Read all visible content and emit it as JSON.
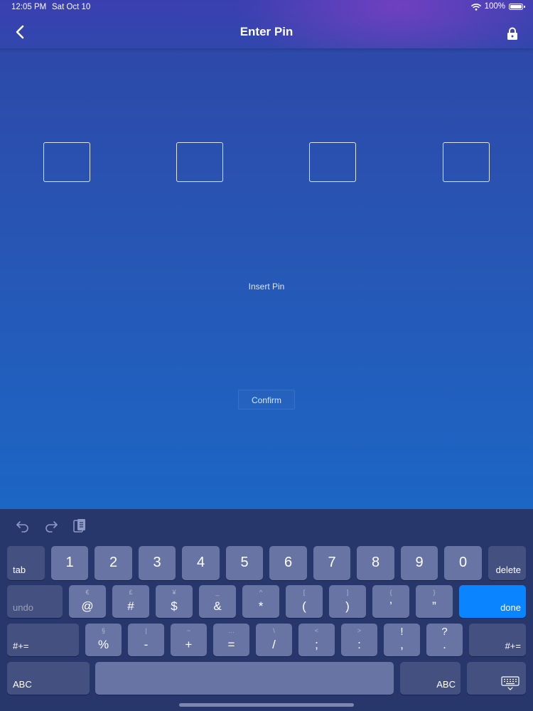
{
  "status": {
    "time": "12:05 PM",
    "date": "Sat Oct 10",
    "battery": "100%"
  },
  "nav": {
    "title": "Enter Pin"
  },
  "pin": {
    "slots": [
      "",
      "",
      "",
      ""
    ],
    "label": "Insert Pin",
    "confirm_label": "Confirm"
  },
  "keyboard": {
    "row1": {
      "tab": "tab",
      "delete": "delete",
      "keys": [
        "1",
        "2",
        "3",
        "4",
        "5",
        "6",
        "7",
        "8",
        "9",
        "0"
      ]
    },
    "row2": {
      "undo": "undo",
      "done": "done",
      "keys": [
        {
          "main": "@",
          "alt": "€"
        },
        {
          "main": "#",
          "alt": "£"
        },
        {
          "main": "$",
          "alt": "¥"
        },
        {
          "main": "&",
          "alt": "_"
        },
        {
          "main": "*",
          "alt": "^"
        },
        {
          "main": "(",
          "alt": "["
        },
        {
          "main": ")",
          "alt": "]"
        },
        {
          "main": "’",
          "alt": "{"
        },
        {
          "main": "”",
          "alt": "}"
        }
      ]
    },
    "row3": {
      "left": "#+=",
      "right": "#+=",
      "keys": [
        {
          "main": "%",
          "alt": "§"
        },
        {
          "main": "-",
          "alt": "|"
        },
        {
          "main": "+",
          "alt": "~"
        },
        {
          "main": "=",
          "alt": "…"
        },
        {
          "main": "/",
          "alt": "\\"
        },
        {
          "main": ";",
          "alt": "<"
        },
        {
          "main": ":",
          "alt": ">"
        },
        {
          "main": ",",
          "alt": "!"
        },
        {
          "main": ".",
          "alt": "?"
        }
      ]
    },
    "row4": {
      "abc_left": "ABC",
      "abc_right": "ABC"
    }
  },
  "colors": {
    "accent_done": "#0a84ff",
    "keyboard_bg": "#27366b"
  }
}
